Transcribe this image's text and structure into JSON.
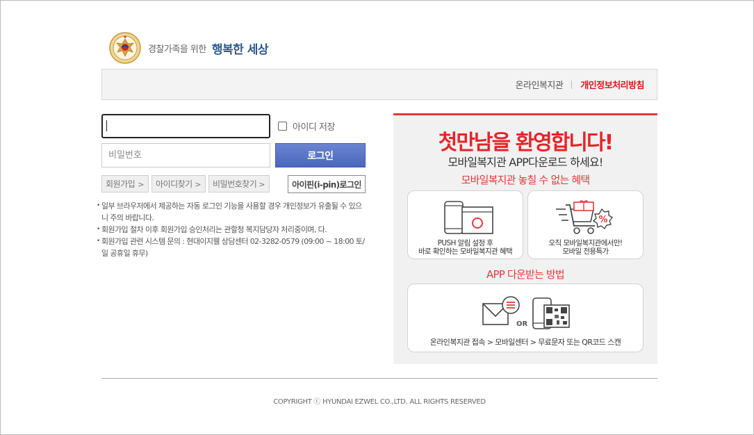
{
  "header": {
    "tagline_small": "경찰가족을 위한",
    "tagline_big": "행복한 세상"
  },
  "topbar": {
    "link_welfare": "온라인복지관",
    "link_privacy": "개인정보처리방침"
  },
  "login": {
    "id_value": "",
    "save_id_label": "아이디 저장",
    "password_placeholder": "비밀번호",
    "login_button": "로그인",
    "join_button": "회원가입",
    "find_id_button": "아이디찾기",
    "find_pw_button": "비밀번호찾기",
    "ipin_button": "아이핀(i-pin)로그인"
  },
  "notes": [
    "일부 브라우저에서 제공하는 자동 로그인 기능을 사용할 경우 개인정보가 유출될 수 있으니 주의 바랍니다.",
    "회원가입 절차 이후 회원가입 승인처리는 관할청 복지담당자 처리중이며, 다.",
    "회원가입 관련 시스템 문의 : 현대이지웰 상담센터 02-3282-0579 (09:00 ~ 18:00 토/일 공휴일 휴무)"
  ],
  "promo": {
    "title": "첫만남을 환영합니다!",
    "subtitle": "모바일복지관 APP다운로드 하세요!",
    "benefits_heading": "모바일복지관 놓칠 수 없는 혜택",
    "benefit1_line1": "PUSH 알림 설정 후",
    "benefit1_line2": "바로 확인하는 모바일복지관 혜택",
    "benefit2_line1": "오직 모바일복지관에서만!",
    "benefit2_line2": "모바일 전용특가",
    "download_heading": "APP 다운받는 방법",
    "or_label": "OR",
    "download_steps": "온라인복지관 접속 > 모바일센터 > 무료문자 또는 QR코드 스캔"
  },
  "footer": {
    "copyright": "COPYRIGHT ⓒ HYUNDAI EZWEL CO.,LTD. ALL RIGHTS RESERVED"
  },
  "colors": {
    "accent_red": "#e5242a",
    "login_blue": "#4a67bd",
    "brand_blue": "#2e5a8d"
  },
  "icons": {
    "emblem": "police-emblem-icon",
    "benefit1": "phone-push-icon",
    "benefit2": "shopping-cart-discount-icon",
    "download1": "message-icon",
    "download2": "qr-code-icon"
  }
}
